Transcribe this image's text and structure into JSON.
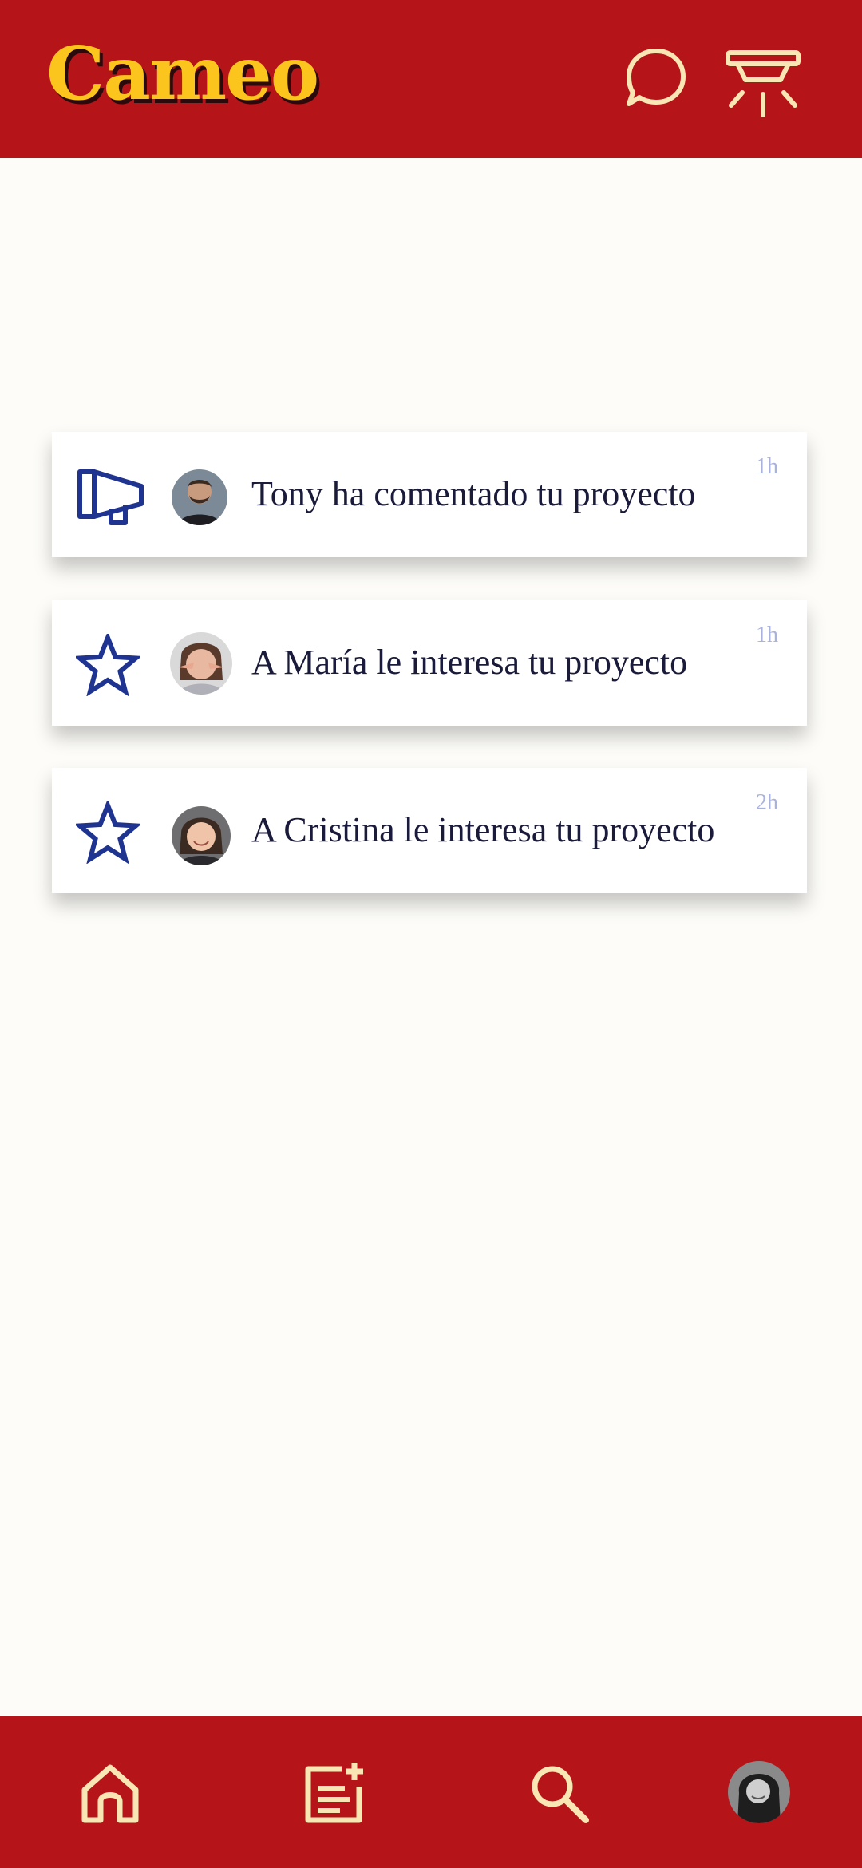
{
  "app": {
    "title": "Cameo"
  },
  "header": {
    "icons": [
      "chat-bubble-icon",
      "ceiling-lamp-icon"
    ]
  },
  "notifications": [
    {
      "type_icon": "megaphone-icon",
      "message": "Tony ha comentado tu proyecto",
      "time": "1h"
    },
    {
      "type_icon": "star-icon",
      "message": "A María le interesa tu proyecto",
      "time": "1h"
    },
    {
      "type_icon": "star-icon",
      "message": "A Cristina le interesa tu proyecto",
      "time": "2h"
    }
  ],
  "bottom_nav": {
    "items": [
      "home-icon",
      "new-post-icon",
      "search-icon",
      "profile-avatar"
    ]
  },
  "colors": {
    "brand_red": "#B51418",
    "logo_yellow": "#FCC51E",
    "icon_cream": "#F8E7B4",
    "icon_blue": "#1F3391",
    "background": "#FDFCF8",
    "time_text": "#A9B2DC"
  }
}
